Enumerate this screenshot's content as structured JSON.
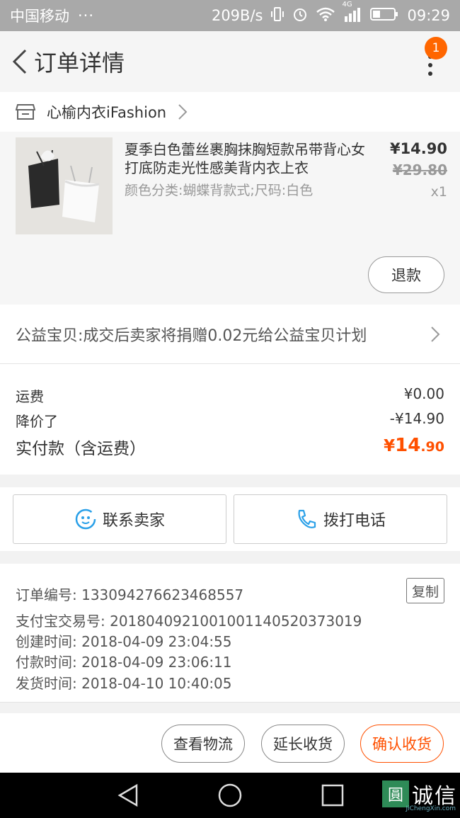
{
  "status_bar": {
    "carrier": "中国移动",
    "dots": "···",
    "speed": "209B/s",
    "network": "4G",
    "time": "09:29"
  },
  "header": {
    "title": "订单详情",
    "notification_count": "1"
  },
  "shop": {
    "name": "心榆内衣iFashion"
  },
  "product": {
    "title": "夏季白色蕾丝裹胸抹胸短款吊带背心女打底防走光性感美背内衣上衣",
    "attributes": "颜色分类:蝴蝶背款式;尺码:白色",
    "price": "¥14.90",
    "original_price": "¥29.80",
    "quantity": "x1",
    "refund_label": "退款"
  },
  "charity": {
    "text": "公益宝贝:成交后卖家将捐赠0.02元给公益宝贝计划"
  },
  "costs": {
    "shipping_label": "运费",
    "shipping_value": "¥0.00",
    "discount_label": "降价了",
    "discount_value": "-¥14.90",
    "paid_label": "实付款（含运费）",
    "paid_currency": "¥",
    "paid_int": "14",
    "paid_dec": ".90"
  },
  "contact": {
    "seller_label": "联系卖家",
    "call_label": "拨打电话"
  },
  "order_info": {
    "order_no": "订单编号: 133094276623468557",
    "copy_label": "复制",
    "alipay_no": "支付宝交易号: 2018040921001001140520373019",
    "created": "创建时间: 2018-04-09 23:04:55",
    "paid": "付款时间: 2018-04-09 23:06:11",
    "shipped": "发货时间: 2018-04-10 10:40:05"
  },
  "actions": {
    "logistics": "查看物流",
    "extend": "延长收货",
    "confirm": "确认收货"
  },
  "watermark": {
    "text": "诚信",
    "sub": "JiChengXin.com"
  },
  "colors": {
    "accent": "#ff5000",
    "badge": "#ff6600",
    "status_bar": "#a9a9a9"
  }
}
